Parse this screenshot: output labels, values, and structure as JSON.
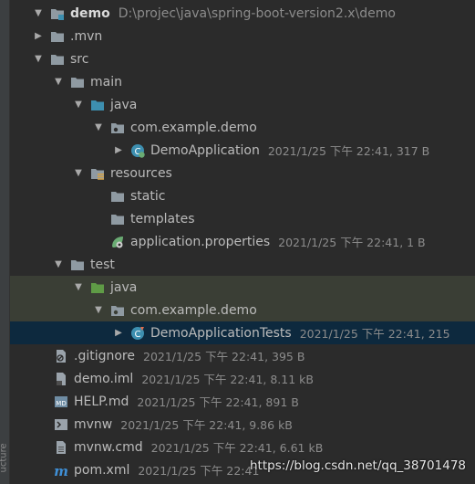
{
  "gutter_label": "ucture",
  "tree": {
    "root": {
      "name": "demo",
      "path": "D:\\projec\\java\\spring-boot-version2.x\\demo"
    },
    "mvn": {
      "name": ".mvn"
    },
    "src": {
      "name": "src"
    },
    "main": {
      "name": "main"
    },
    "main_java": {
      "name": "java"
    },
    "main_pkg": {
      "name": "com.example.demo"
    },
    "demo_app": {
      "name": "DemoApplication",
      "meta": "2021/1/25 下午 22:41, 317 B"
    },
    "resources": {
      "name": "resources"
    },
    "static": {
      "name": "static"
    },
    "templates": {
      "name": "templates"
    },
    "app_props": {
      "name": "application.properties",
      "meta": "2021/1/25 下午 22:41, 1 B"
    },
    "test": {
      "name": "test"
    },
    "test_java": {
      "name": "java"
    },
    "test_pkg": {
      "name": "com.example.demo"
    },
    "demo_tests": {
      "name": "DemoApplicationTests",
      "meta": "2021/1/25 下午 22:41, 215"
    },
    "gitignore": {
      "name": ".gitignore",
      "meta": "2021/1/25 下午 22:41, 395 B"
    },
    "demo_iml": {
      "name": "demo.iml",
      "meta": "2021/1/25 下午 22:41, 8.11 kB"
    },
    "help_md": {
      "name": "HELP.md",
      "meta": "2021/1/25 下午 22:41, 891 B"
    },
    "mvnw": {
      "name": "mvnw",
      "meta": "2021/1/25 下午 22:41, 9.86 kB"
    },
    "mvnw_cmd": {
      "name": "mvnw.cmd",
      "meta": "2021/1/25 下午 22:41, 6.61 kB"
    },
    "pom_xml": {
      "name": "pom.xml",
      "meta": "2021/1/25 下午 22:41"
    }
  },
  "watermark": "https://blog.csdn.net/qq_38701478",
  "colors": {
    "background": "#2b2b2b",
    "folder": "#8f9aa2",
    "source_folder": "#3d8fb0",
    "test_folder": "#5f9b46",
    "selection": "#0d293e",
    "test_highlight": "#3a3e35"
  }
}
